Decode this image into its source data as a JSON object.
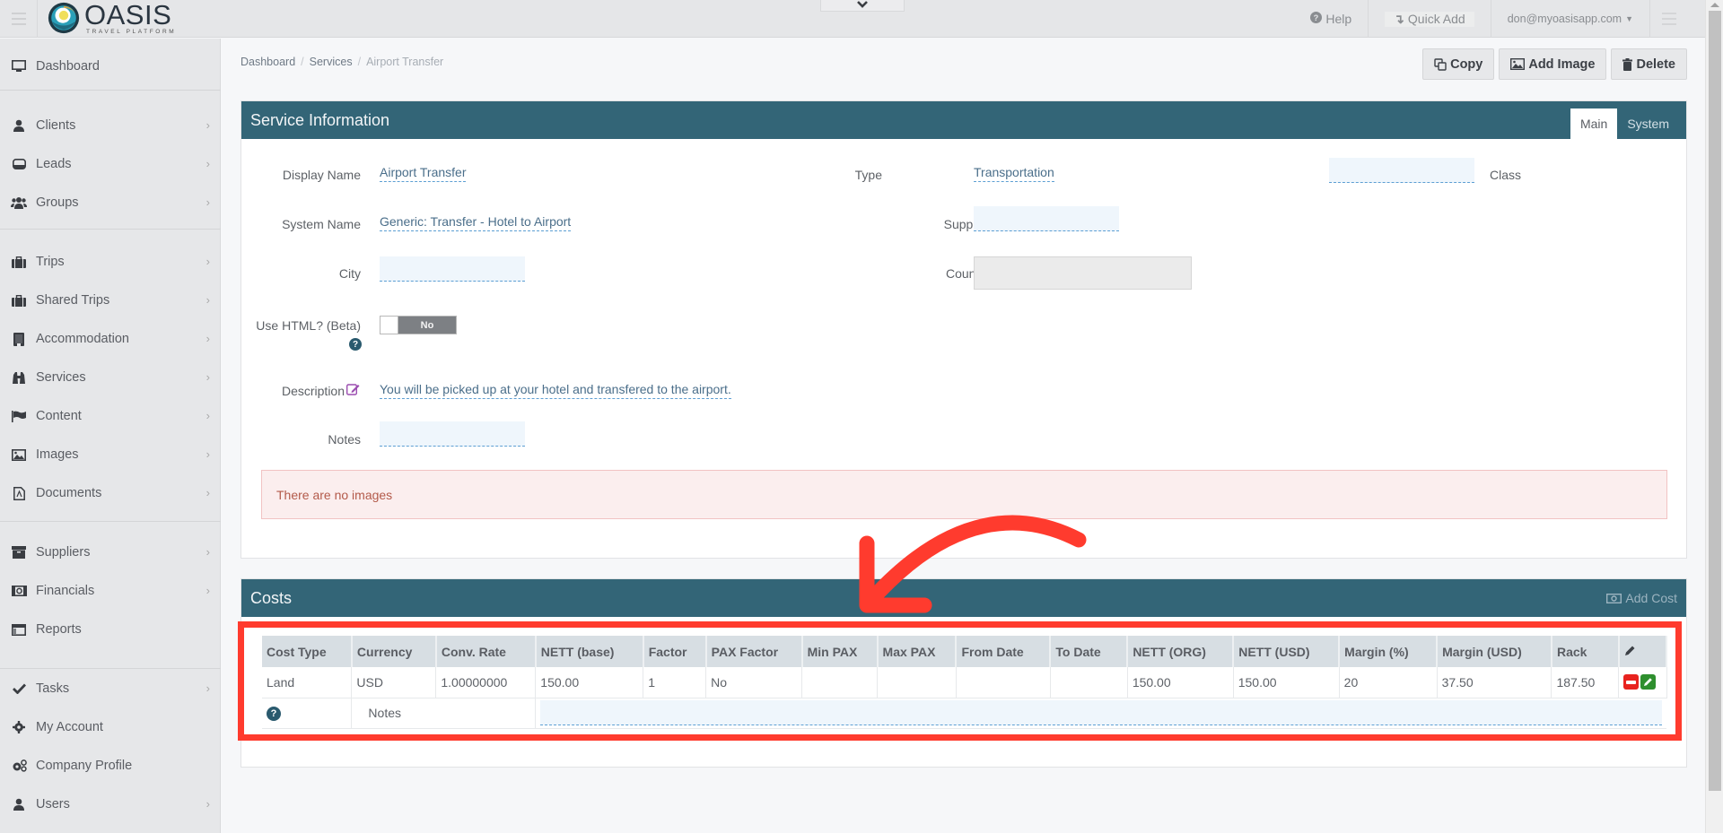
{
  "header": {
    "logo": {
      "word": "OASIS",
      "tagline": "TRAVEL PLATFORM"
    },
    "help_label": "Help",
    "quick_add_label": "Quick Add",
    "user_email": "don@myoasisapp.com"
  },
  "sidebar": {
    "items": [
      {
        "label": "Dashboard",
        "icon": "desktop-icon",
        "has_children": false
      },
      {
        "label": "Clients",
        "icon": "user-icon",
        "has_children": true
      },
      {
        "label": "Leads",
        "icon": "inbox-icon",
        "has_children": true
      },
      {
        "label": "Groups",
        "icon": "users-icon",
        "has_children": true
      },
      {
        "label": "Trips",
        "icon": "briefcase-icon",
        "has_children": true
      },
      {
        "label": "Shared Trips",
        "icon": "briefcase-icon",
        "has_children": true
      },
      {
        "label": "Accommodation",
        "icon": "building-icon",
        "has_children": true
      },
      {
        "label": "Services",
        "icon": "binoculars-icon",
        "has_children": true
      },
      {
        "label": "Content",
        "icon": "flag-icon",
        "has_children": true
      },
      {
        "label": "Images",
        "icon": "image-icon",
        "has_children": true
      },
      {
        "label": "Documents",
        "icon": "pdf-file-icon",
        "has_children": true
      },
      {
        "label": "Suppliers",
        "icon": "archive-icon",
        "has_children": true
      },
      {
        "label": "Financials",
        "icon": "money-icon",
        "has_children": true
      },
      {
        "label": "Reports",
        "icon": "report-icon",
        "has_children": false
      },
      {
        "label": "Tasks",
        "icon": "check-icon",
        "has_children": true
      },
      {
        "label": "My Account",
        "icon": "gear-icon",
        "has_children": false
      },
      {
        "label": "Company Profile",
        "icon": "gears-icon",
        "has_children": false
      },
      {
        "label": "Users",
        "icon": "user-icon",
        "has_children": true
      }
    ]
  },
  "breadcrumb": {
    "items": [
      "Dashboard",
      "Services"
    ],
    "current": "Airport Transfer",
    "separator": "/"
  },
  "actions": {
    "copy_label": "Copy",
    "add_image_label": "Add Image",
    "delete_label": "Delete"
  },
  "service_info": {
    "title": "Service Information",
    "tabs": [
      {
        "label": "Main",
        "active": true
      },
      {
        "label": "System",
        "active": false
      }
    ],
    "fields": {
      "display_name": {
        "label": "Display Name",
        "value": "Airport Transfer"
      },
      "system_name": {
        "label": "System Name",
        "value": "Generic: Transfer - Hotel to Airport"
      },
      "city": {
        "label": "City",
        "value": ""
      },
      "use_html": {
        "label": "Use HTML? (Beta)",
        "value": "No"
      },
      "description": {
        "label": "Description",
        "value": "You will be picked up at your hotel and transfered to the airport."
      },
      "notes": {
        "label": "Notes",
        "value": ""
      },
      "type": {
        "label": "Type",
        "value": "Transportation"
      },
      "supplier": {
        "label": "Supplier",
        "value": ""
      },
      "country": {
        "label": "Country",
        "value": ""
      },
      "class": {
        "label": "Class",
        "value": ""
      }
    },
    "no_images_message": "There are no images"
  },
  "costs": {
    "title": "Costs",
    "add_cost_label": "Add Cost",
    "columns": [
      "Cost Type",
      "Currency",
      "Conv. Rate",
      "NETT (base)",
      "Factor",
      "PAX Factor",
      "Min PAX",
      "Max PAX",
      "From Date",
      "To Date",
      "NETT (ORG)",
      "NETT (USD)",
      "Margin (%)",
      "Margin (USD)",
      "Rack"
    ],
    "rows": [
      {
        "cells": [
          "Land",
          "USD",
          "1.00000000",
          "150.00",
          "1",
          "No",
          "",
          "",
          "",
          "",
          "150.00",
          "150.00",
          "20",
          "37.50",
          "187.50"
        ],
        "notes_label": "Notes",
        "notes_value": ""
      }
    ]
  },
  "annotation": {
    "color": "#ff3b2e"
  }
}
